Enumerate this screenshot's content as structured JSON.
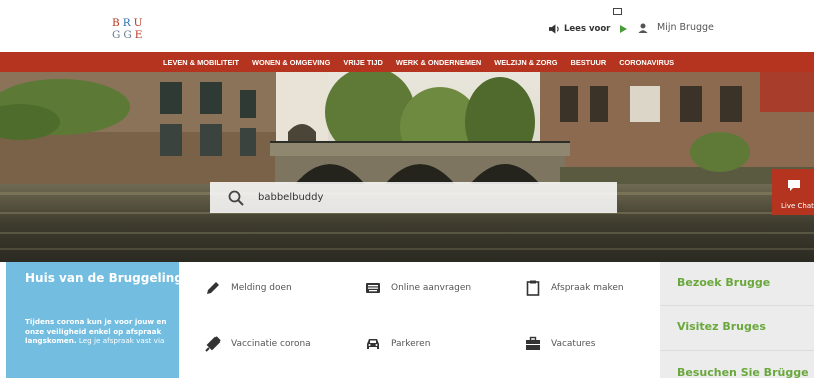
{
  "logo": {
    "row1": [
      "B",
      "R",
      "U"
    ],
    "row2": [
      "G",
      "G",
      "E"
    ],
    "colors": [
      "#b5341f",
      "#2b6cb0",
      "#b5341f",
      "#6b7d8c",
      "#6b7d8c",
      "#b5341f"
    ]
  },
  "header": {
    "lees_voor": "Lees voor",
    "mijn_brugge": "Mijn Brugge"
  },
  "nav": {
    "items": [
      "LEVEN & MOBILITEIT",
      "WONEN & OMGEVING",
      "VRIJE TIJD",
      "WERK & ONDERNEMEN",
      "WELZIJN & ZORG",
      "BESTUUR",
      "CORONAVIRUS"
    ]
  },
  "search": {
    "value": "babbelbuddy"
  },
  "livechat": {
    "label": "Live Chat"
  },
  "huis": {
    "title": "Huis van de Bruggeling",
    "body_bold": "Tijdens corona kun je voor jouw en onze veiligheid enkel op afspraak langskomen.",
    "body_rest": " Leg je afspraak vast via"
  },
  "services": [
    {
      "label": "Melding doen",
      "icon": "pencil-icon"
    },
    {
      "label": "Online aanvragen",
      "icon": "keyboard-icon"
    },
    {
      "label": "Afspraak maken",
      "icon": "clipboard-icon"
    },
    {
      "label": "Vaccinatie corona",
      "icon": "syringe-icon"
    },
    {
      "label": "Parkeren",
      "icon": "car-icon"
    },
    {
      "label": "Vacatures",
      "icon": "briefcase-icon"
    }
  ],
  "links": [
    "Bezoek Brugge",
    "Visitez Bruges",
    "Besuchen Sie Brügge"
  ],
  "colors": {
    "brand_red": "#b5341f",
    "light_blue": "#72bde0",
    "green": "#6aa83d",
    "grey_panel": "#ececec"
  }
}
